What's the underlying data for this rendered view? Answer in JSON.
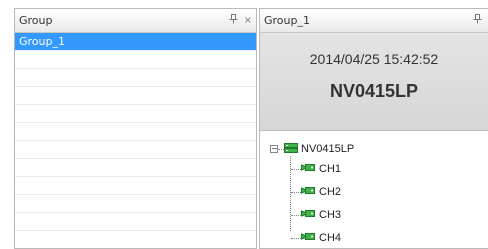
{
  "left_panel": {
    "title": "Group",
    "pin_glyph": "ᵃ",
    "close_glyph": "×",
    "rows": [
      "Group_1",
      "",
      "",
      "",
      "",
      "",
      "",
      "",
      "",
      "",
      "",
      ""
    ]
  },
  "right_panel": {
    "title": "Group_1",
    "pin_glyph": "ᵃ",
    "datetime": "2014/04/25 15:42:52",
    "device_name": "NV0415LP",
    "tree": {
      "root_label": "NV0415LP",
      "expander": "−",
      "channels": [
        "CH1",
        "CH2",
        "CH3",
        "CH4"
      ]
    }
  },
  "colors": {
    "selection": "#3399ff",
    "icon_green": "#2e9e3a"
  }
}
